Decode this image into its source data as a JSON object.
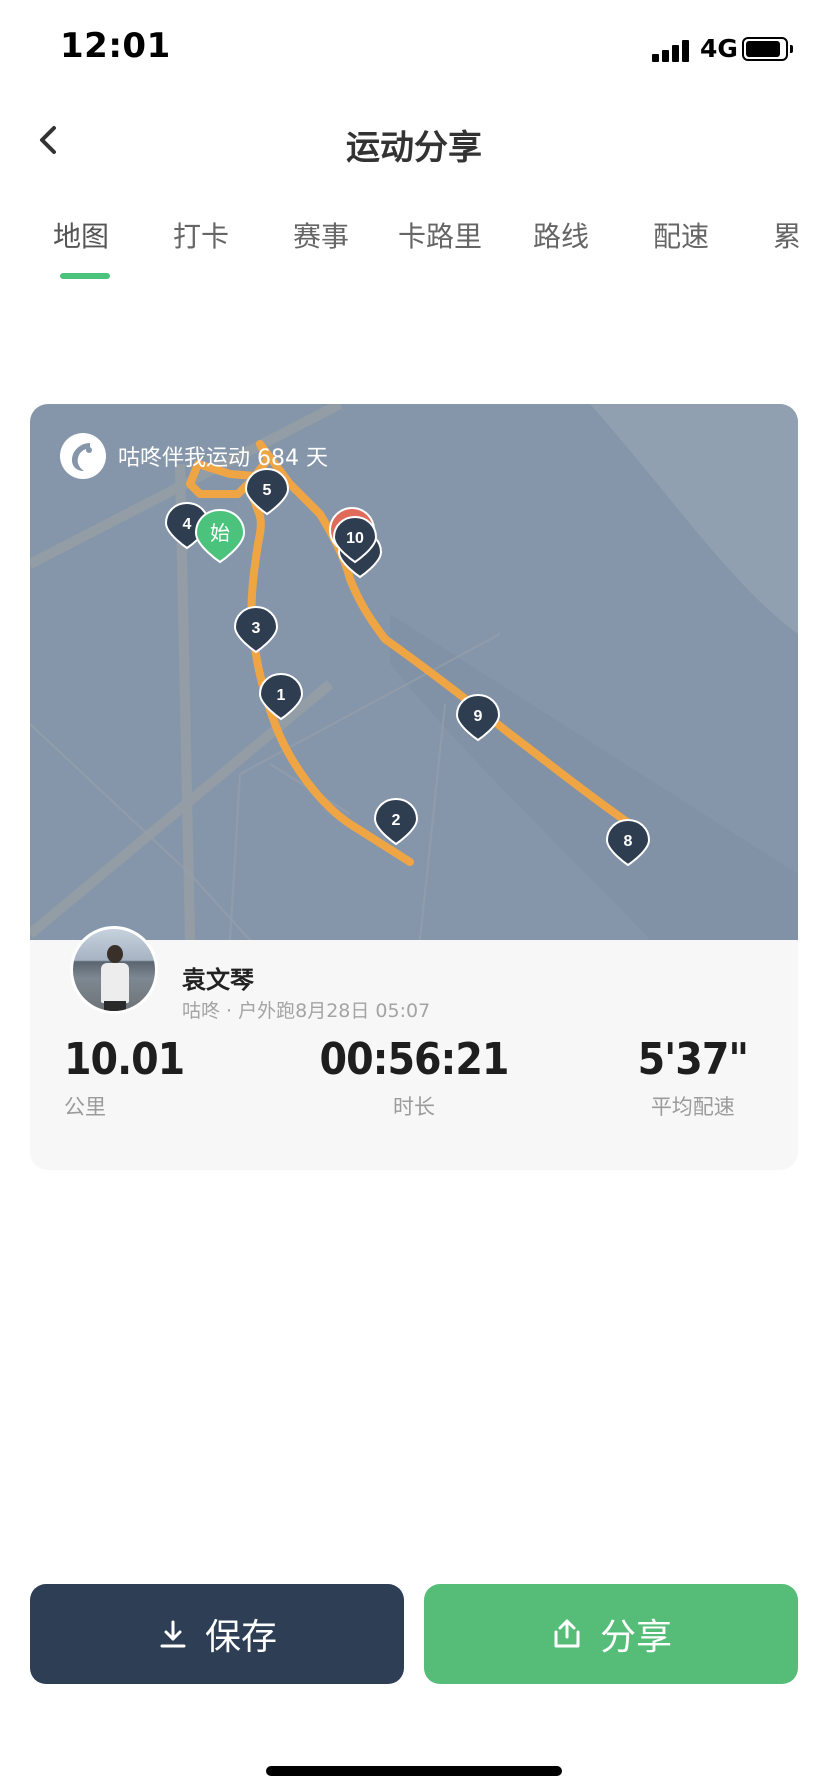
{
  "status_bar": {
    "time": "12:01",
    "network": "4G"
  },
  "nav": {
    "title": "运动分享"
  },
  "tabs": [
    {
      "label": "地图",
      "active": true
    },
    {
      "label": "打卡"
    },
    {
      "label": "赛事"
    },
    {
      "label": "卡路里"
    },
    {
      "label": "路线"
    },
    {
      "label": "配速"
    },
    {
      "label": "累"
    }
  ],
  "map": {
    "badge_text": "咕咚伴我运动 684 天",
    "start_label": "始",
    "markers": [
      "1",
      "2",
      "3",
      "4",
      "5",
      "8",
      "9",
      "10"
    ]
  },
  "profile": {
    "name": "袁文琴",
    "meta": "咕咚 · 户外跑8月28日 05:07"
  },
  "stats": [
    {
      "value": "10.01",
      "label": "公里"
    },
    {
      "value": "00:56:21",
      "label": "时长"
    },
    {
      "value": "5'37\"",
      "label": "平均配速"
    }
  ],
  "buttons": {
    "save": "保存",
    "share": "分享"
  },
  "colors": {
    "accent": "#4cc37c",
    "save_button": "#2d3e55",
    "share_button": "#56bd78",
    "route": "#f0a544"
  }
}
